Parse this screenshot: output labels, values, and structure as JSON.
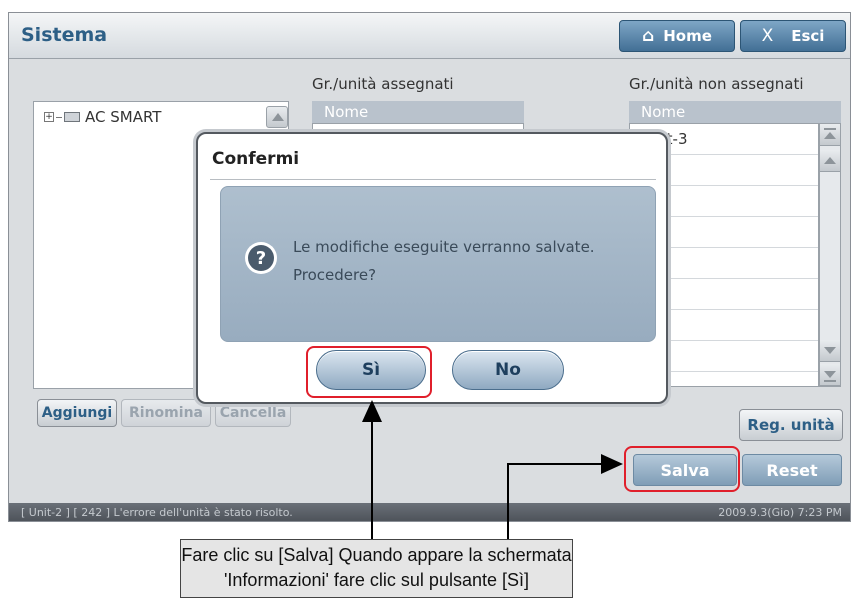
{
  "window": {
    "title": "Sistema"
  },
  "header": {
    "home_label": "Home",
    "exit_label": "Esci",
    "home_icon": "home-icon",
    "exit_icon": "x-icon"
  },
  "tree": {
    "label": "AC SMART"
  },
  "assigned": {
    "title": "Gr./unità assegnati",
    "column": "Nome"
  },
  "unassigned": {
    "title": "Gr./unità non assegnati",
    "column": "Nome",
    "items": [
      "Unit-3"
    ]
  },
  "buttons": {
    "add": "Aggiungi",
    "rename": "Rinomina",
    "delete": "Cancella",
    "reg": "Reg. unità",
    "save": "Salva",
    "reset": "Reset"
  },
  "status": {
    "message": "[ Unit-2 ] [ 242 ] L'errore dell'unità è stato risolto.",
    "datetime": "2009.9.3(Gio) 7:23 PM"
  },
  "dialog": {
    "title": "Confermi",
    "line1": "Le modifiche eseguite verranno salvate.",
    "line2": "Procedere?",
    "yes": "Sì",
    "no": "No",
    "icon": "question-icon"
  },
  "annotation": {
    "line1": "Fare clic su [Salva] Quando appare la schermata",
    "line2": "'Informazioni' fare clic sul pulsante [Sì]"
  },
  "colors": {
    "accent": "#2d5f86",
    "highlight": "#e01f2b"
  }
}
